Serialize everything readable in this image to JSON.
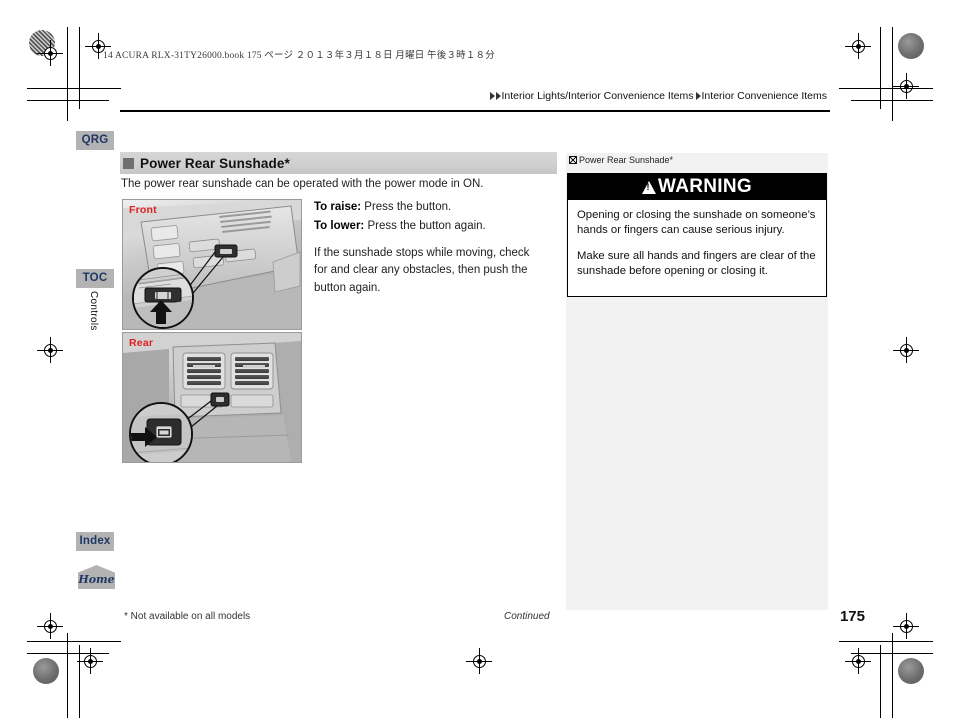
{
  "document": {
    "file_stamp": "14 ACURA RLX-31TY26000.book   175 ページ   ２０１３年３月１８日   月曜日   午後３時１８分",
    "page_number": "175",
    "footnote": "* Not available on all models",
    "continued": "Continued"
  },
  "breadcrumb": {
    "part1": "Interior Lights/Interior Convenience Items",
    "part2": "Interior Convenience Items"
  },
  "sidebar": {
    "tabs": [
      {
        "id": "qrg",
        "label": "QRG"
      },
      {
        "id": "toc",
        "label": "TOC"
      },
      {
        "id": "index",
        "label": "Index"
      },
      {
        "id": "home",
        "label": "Home"
      }
    ],
    "chapter_label": "Controls"
  },
  "main": {
    "section_title": "Power Rear Sunshade*",
    "intro": "The power rear sunshade can be operated with the power mode in ON.",
    "figures": [
      {
        "label": "Front",
        "name": "front-overhead-console-photo"
      },
      {
        "label": "Rear",
        "name": "rear-console-photo"
      }
    ],
    "instructions": [
      {
        "bold": "To raise:",
        "rest": " Press the button."
      },
      {
        "bold": "To lower:",
        "rest": " Press the button again."
      }
    ],
    "paragraph": "If the sunshade stops while moving, check for and clear any obstacles, then push the button again."
  },
  "sidenote": {
    "title": "Power Rear Sunshade*",
    "warning_label": "WARNING",
    "warning_paragraphs": [
      "Opening or closing the sunshade on someone’s hands or fingers can cause serious injury.",
      "Make sure all hands and fingers are clear of the sunshade before opening or closing it."
    ]
  },
  "colors": {
    "tab_bg": "#b3b3b3",
    "tab_text": "#1f3864",
    "heading_bar": "#cfcfcf",
    "note_bg": "#f2f2f2",
    "warning_bg": "#000000",
    "figure_label": "#e02020"
  }
}
